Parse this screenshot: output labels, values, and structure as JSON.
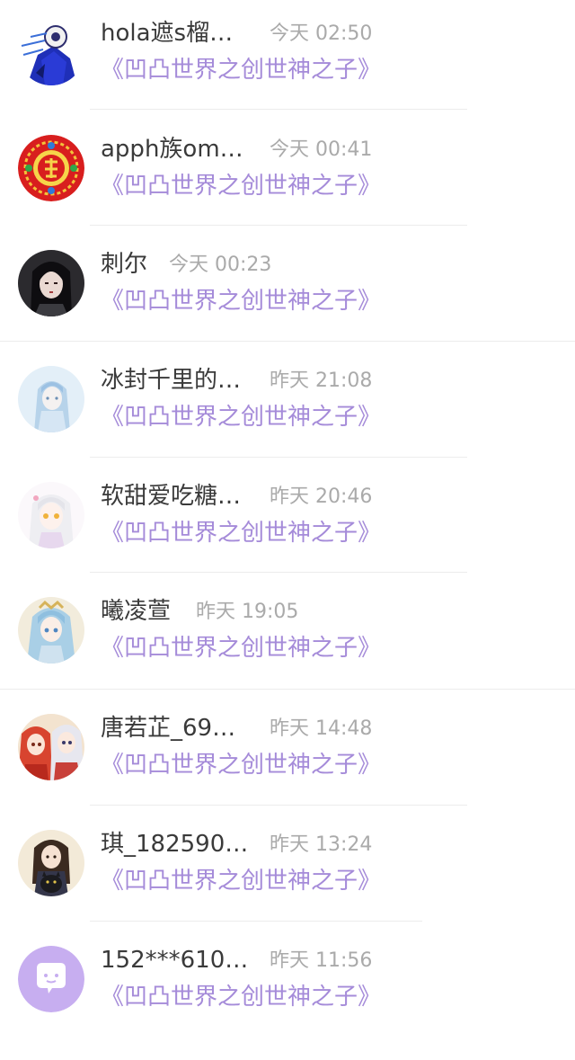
{
  "messages": [
    {
      "name": "hola遮s榴…",
      "time": "今天 02:50",
      "work": "《凹凸世界之创世神之子》",
      "avatar": "anime-hooded-avatar"
    },
    {
      "name": "apph族om…",
      "time": "今天 00:41",
      "work": "《凹凸世界之创世神之子》",
      "avatar": "red-fu-character-avatar"
    },
    {
      "name": "刺尔",
      "time": "今天 00:23",
      "work": "《凹凸世界之创世神之子》",
      "avatar": "dark-hair-girl-avatar"
    },
    {
      "name": "冰封千里的…",
      "time": "昨天 21:08",
      "work": "《凹凸世界之创世神之子》",
      "avatar": "pale-blue-girl-avatar"
    },
    {
      "name": "软甜爱吃糖…",
      "time": "昨天 20:46",
      "work": "《凹凸世界之创世神之子》",
      "avatar": "white-hair-anime-avatar"
    },
    {
      "name": "曦凌萱",
      "time": "昨天 19:05",
      "work": "《凹凸世界之创世神之子》",
      "avatar": "blue-hair-anime-avatar"
    },
    {
      "name": "唐若芷_69…",
      "time": "昨天 14:48",
      "work": "《凹凸世界之创世神之子》",
      "avatar": "red-anime-pair-avatar"
    },
    {
      "name": "琪_182590…",
      "time": "昨天 13:24",
      "work": "《凹凸世界之创世神之子》",
      "avatar": "girl-with-cat-avatar"
    },
    {
      "name": "152***610…",
      "time": "昨天 11:56",
      "work": "《凹凸世界之创世神之子》",
      "avatar": "default-chat-bubble-avatar"
    }
  ],
  "colors": {
    "name": "#3a3a3a",
    "time": "#aaaaaa",
    "work": "#a58bd9",
    "default_avatar": "#c7aef0"
  }
}
